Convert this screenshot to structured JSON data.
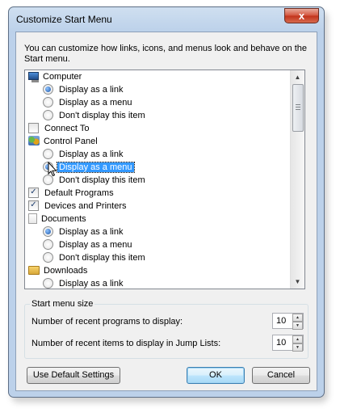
{
  "window": {
    "title": "Customize Start Menu",
    "close_glyph": "x",
    "intro": "You can customize how links, icons, and menus look and behave on the Start menu."
  },
  "list": [
    {
      "kind": "header",
      "icon": "computer-icon",
      "label": "Computer"
    },
    {
      "kind": "radio",
      "label": "Display as a link",
      "checked": true
    },
    {
      "kind": "radio",
      "label": "Display as a menu",
      "checked": false
    },
    {
      "kind": "radio",
      "label": "Don't display this item",
      "checked": false
    },
    {
      "kind": "check",
      "label": "Connect To",
      "checked": false
    },
    {
      "kind": "header",
      "icon": "control-panel-icon",
      "label": "Control Panel"
    },
    {
      "kind": "radio",
      "label": "Display as a link",
      "checked": false
    },
    {
      "kind": "radio",
      "label": "Display as a menu",
      "checked": true,
      "selected": true
    },
    {
      "kind": "radio",
      "label": "Don't display this item",
      "checked": false
    },
    {
      "kind": "check",
      "label": "Default Programs",
      "checked": true
    },
    {
      "kind": "check",
      "label": "Devices and Printers",
      "checked": true
    },
    {
      "kind": "header",
      "icon": "documents-icon",
      "label": "Documents"
    },
    {
      "kind": "radio",
      "label": "Display as a link",
      "checked": true
    },
    {
      "kind": "radio",
      "label": "Display as a menu",
      "checked": false
    },
    {
      "kind": "radio",
      "label": "Don't display this item",
      "checked": false
    },
    {
      "kind": "header",
      "icon": "downloads-folder-icon",
      "label": "Downloads"
    },
    {
      "kind": "radio",
      "label": "Display as a link",
      "checked": false
    }
  ],
  "size_group": {
    "title": "Start menu size",
    "recent_programs_label": "Number of recent programs to display:",
    "recent_programs_value": "10",
    "jump_list_label": "Number of recent items to display in Jump Lists:",
    "jump_list_value": "10"
  },
  "buttons": {
    "defaults": "Use Default Settings",
    "ok": "OK",
    "cancel": "Cancel"
  },
  "colors": {
    "selection": "#3399ff",
    "close_button": "#c1321a"
  }
}
